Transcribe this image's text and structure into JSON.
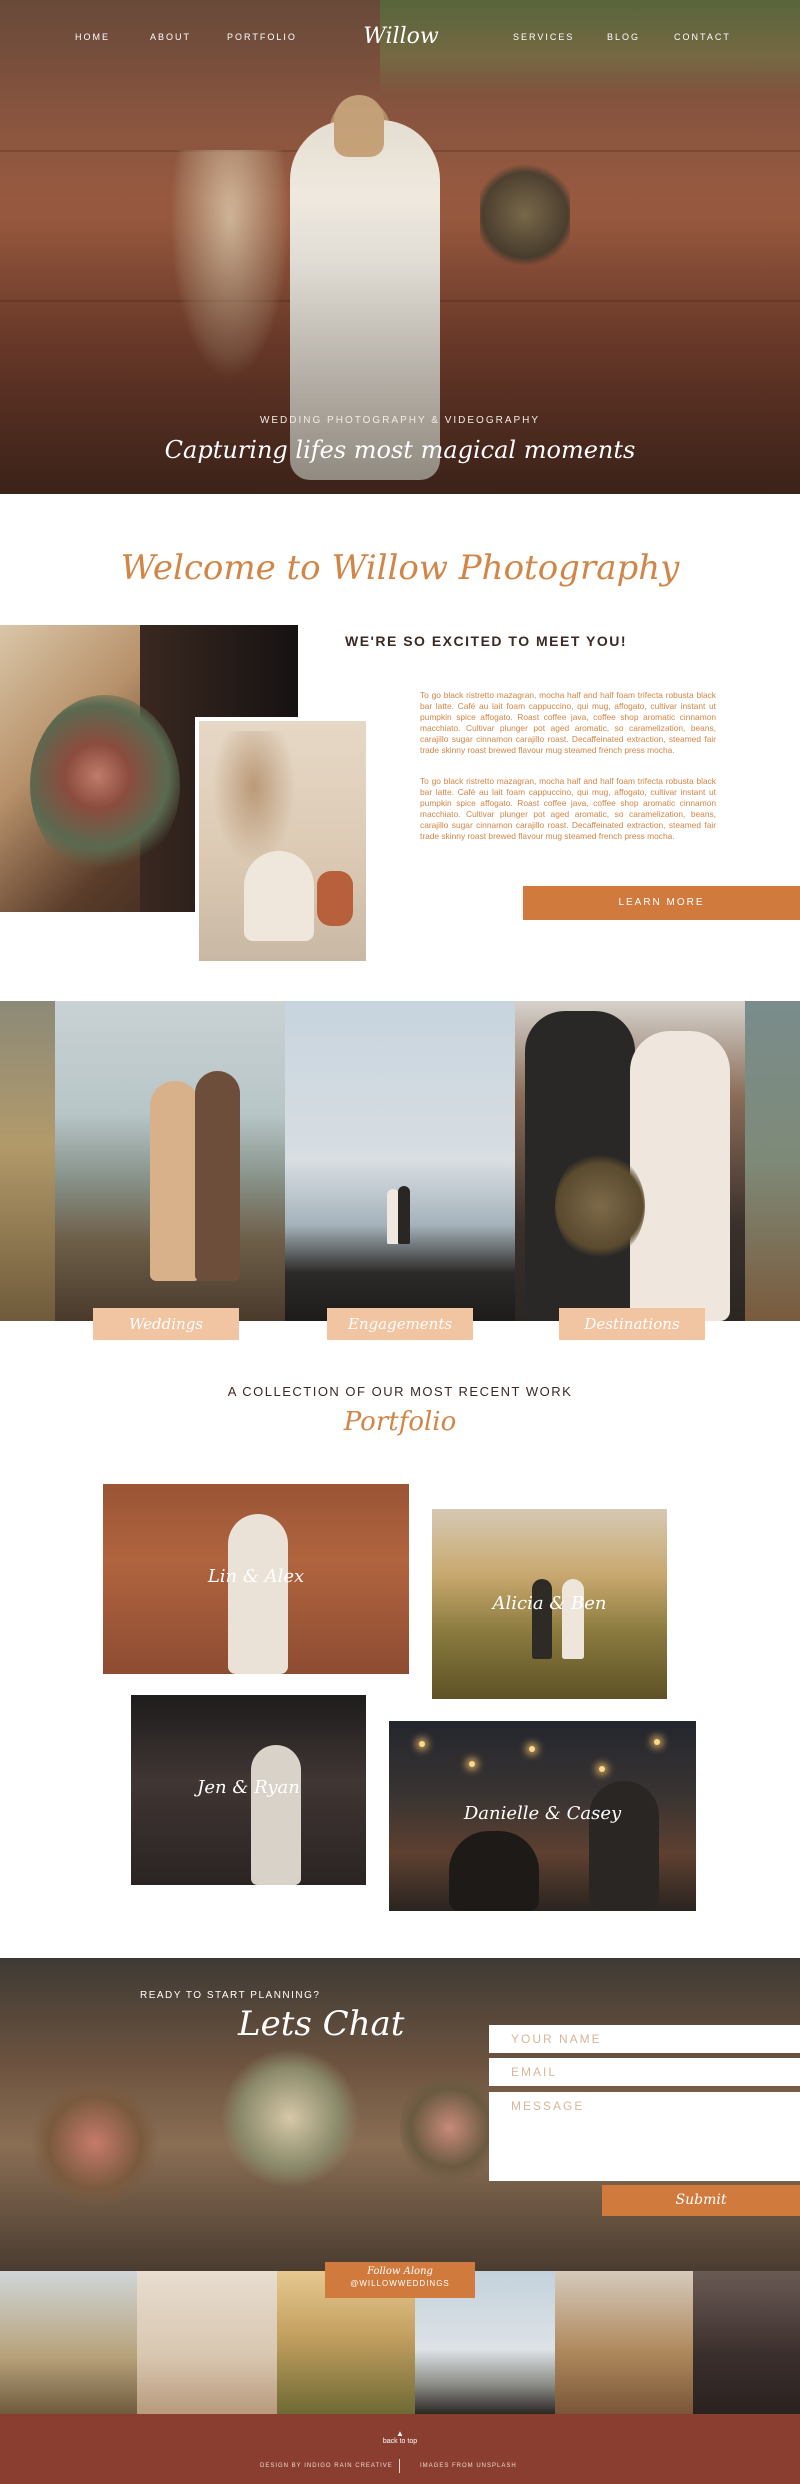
{
  "nav": {
    "logo": "Willow",
    "home": "HOME",
    "about": "ABOUT",
    "portfolio": "PORTFOLIO",
    "services": "SERVICES",
    "blog": "BLOG",
    "contact": "CONTACT"
  },
  "hero": {
    "subtitle": "WEDDING PHOTOGRAPHY & VIDEOGRAPHY",
    "tagline": "Capturing lifes most magical moments"
  },
  "welcome": {
    "title": "Welcome to Willow Photography",
    "heading": "WE'RE SO EXCITED TO MEET YOU!",
    "paragraph1": "To go black ristretto mazagran, mocha half and half foam trifecta robusta black bar latte. Café au lait foam cappuccino, qui mug, affogato, cultivar instant ut pumpkin spice affogato. Roast coffee java, coffee shop aromatic cinnamon macchiato. Cultivar plunger pot aged aromatic, so caramelization, beans, carajillo sugar cinnamon carajillo roast. Decaffeinated extraction, steamed fair trade skinny roast brewed flavour mug steamed french press mocha.",
    "paragraph2": "To go black ristretto mazagran, mocha half and half foam trifecta robusta black bar latte. Café au lait foam cappuccino, qui mug, affogato, cultivar instant ut pumpkin spice affogato. Roast coffee java, coffee shop aromatic cinnamon macchiato. Cultivar plunger pot aged aromatic, so caramelization, beans, carajillo sugar cinnamon carajillo roast. Decaffeinated extraction, steamed fair trade skinny roast brewed flavour mug steamed french press mocha.",
    "button": "LEARN MORE"
  },
  "services": {
    "items": [
      {
        "label": "Weddings"
      },
      {
        "label": "Engagements"
      },
      {
        "label": "Destinations"
      }
    ]
  },
  "portfolio": {
    "intro": "A COLLECTION OF OUR MOST RECENT WORK",
    "title": "Portfolio",
    "items": [
      {
        "caption": "Lin & Alex"
      },
      {
        "caption": "Alicia & Ben"
      },
      {
        "caption": "Jen & Ryan"
      },
      {
        "caption": "Danielle & Casey"
      }
    ]
  },
  "contact": {
    "kicker": "READY TO START PLANNING?",
    "title": "Lets Chat",
    "name_placeholder": "YOUR NAME",
    "email_placeholder": "EMAIL",
    "message_placeholder": "MESSAGE",
    "submit": "Submit"
  },
  "instagram": {
    "follow": "Follow Along",
    "handle": "@WILLOWWEDDINGS"
  },
  "footer": {
    "back_to_top": "back to top",
    "design_credit": "DESIGN BY INDIGO RAIN CREATIVE",
    "image_credit": "IMAGES FROM UNSPLASH"
  },
  "colors": {
    "accent": "#d17a3e",
    "accent_light": "#f1c4a2",
    "footer": "#8a3e30"
  }
}
